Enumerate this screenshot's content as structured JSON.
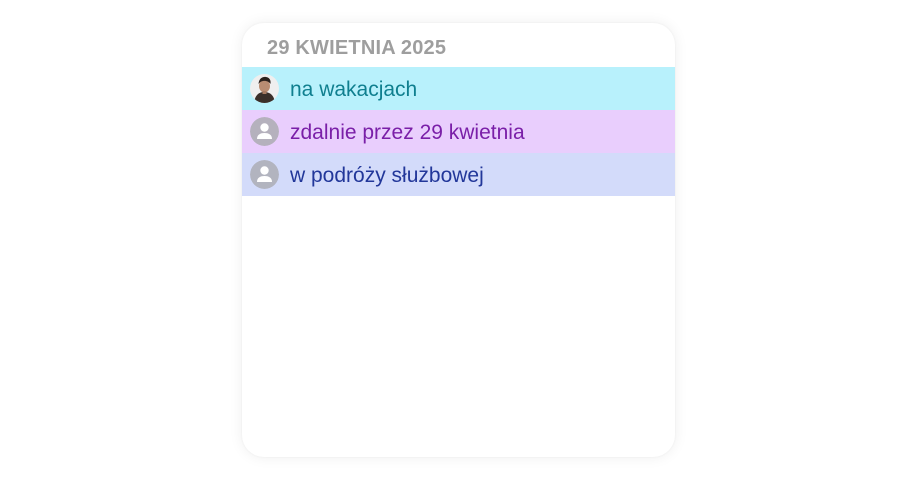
{
  "header": {
    "date": "29 KWIETNIA 2025"
  },
  "statuses": [
    {
      "label": "na wakacjach",
      "avatar": "person-photo-icon",
      "background": "#b8f1fc",
      "text_color": "#0f7f8f"
    },
    {
      "label": "zdalnie przez 29 kwietnia",
      "avatar": "default-user-icon",
      "background": "#e9cefd",
      "text_color": "#7a1fa8"
    },
    {
      "label": "w podróży służbowej",
      "avatar": "default-user-icon",
      "background": "#d3dbfa",
      "text_color": "#22379a"
    }
  ]
}
